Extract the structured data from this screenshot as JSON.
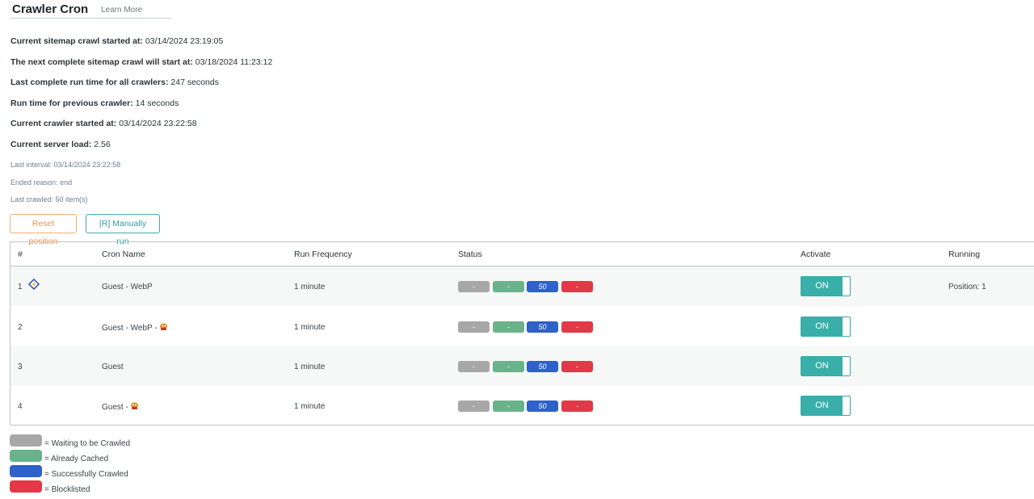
{
  "header": {
    "title": "Crawler Cron",
    "learn_more": "Learn More"
  },
  "info": [
    {
      "label": "Current sitemap crawl started at:",
      "value": "03/14/2024 23:19:05"
    },
    {
      "label": "The next complete sitemap crawl will start at:",
      "value": "03/18/2024 11:23:12"
    },
    {
      "label": "Last complete run time for all crawlers:",
      "value": "247 seconds"
    },
    {
      "label": "Run time for previous crawler:",
      "value": "14 seconds"
    },
    {
      "label": "Current crawler started at:",
      "value": "03/14/2024 23:22:58"
    },
    {
      "label": "Current server load:",
      "value": "2.56"
    }
  ],
  "sub_info": [
    {
      "label": "Last interval:",
      "value": "03/14/2024 23:22:58"
    },
    {
      "label": "Ended reason:",
      "value": "end"
    },
    {
      "label": "Last crawled:",
      "value": "50 item(s)"
    }
  ],
  "buttons": {
    "reset": "Reset position",
    "manual_run": "[R] Manually run"
  },
  "table": {
    "headers": [
      "#",
      "Cron Name",
      "Run Frequency",
      "Status",
      "Activate",
      "Running"
    ],
    "rows": [
      {
        "num": "1",
        "name": "Guest - WebP",
        "frequency": "1 minute",
        "status": [
          "-",
          "-",
          "50",
          "-"
        ],
        "activate": "ON",
        "running": "Position: 1"
      },
      {
        "num": "2",
        "name": "Guest - WebP -",
        "frequency": "1 minute",
        "status": [
          "-",
          "-",
          "50",
          "-"
        ],
        "activate": "ON",
        "running": ""
      },
      {
        "num": "3",
        "name": "Guest",
        "frequency": "1 minute",
        "status": [
          "-",
          "-",
          "50",
          "-"
        ],
        "activate": "ON",
        "running": ""
      },
      {
        "num": "4",
        "name": "Guest -",
        "frequency": "1 minute",
        "status": [
          "-",
          "-",
          "50",
          "-"
        ],
        "activate": "ON",
        "running": ""
      }
    ]
  },
  "legend": [
    {
      "text": "= Waiting to be Crawled",
      "color": "#a7a7a7"
    },
    {
      "text": "= Already Cached",
      "color": "#6ab38a"
    },
    {
      "text": "= Successfully Crawled",
      "color": "#2e61c9"
    },
    {
      "text": "= Blocklisted",
      "color": "#e33847"
    }
  ]
}
